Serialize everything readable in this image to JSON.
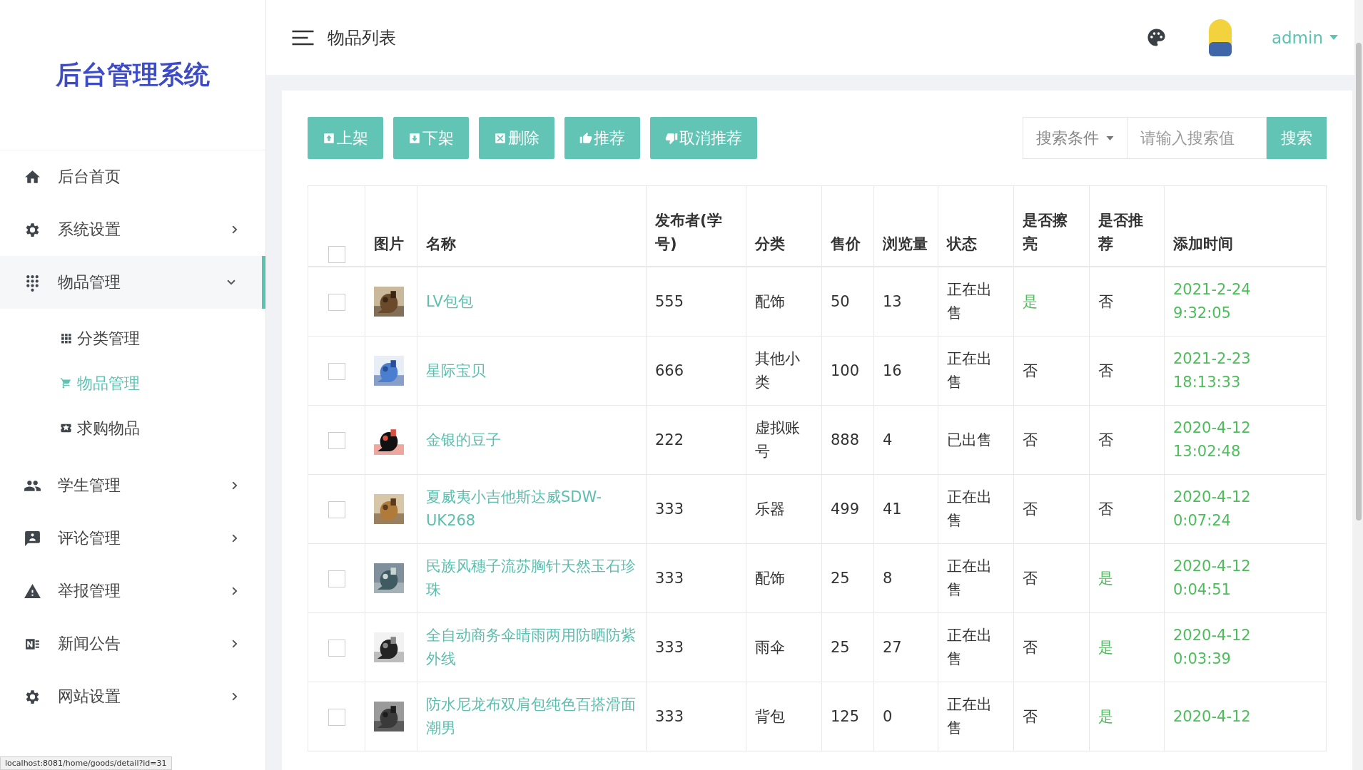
{
  "sidebar": {
    "title": "后台管理系统",
    "items": [
      {
        "label": "后台首页",
        "selected": false
      },
      {
        "label": "系统设置",
        "selected": false,
        "expanded": false
      },
      {
        "label": "物品管理",
        "selected": true,
        "expanded": true,
        "children": [
          {
            "label": "分类管理",
            "selected": false
          },
          {
            "label": "物品管理",
            "selected": true
          },
          {
            "label": "求购物品",
            "selected": false
          }
        ]
      },
      {
        "label": "学生管理",
        "selected": false,
        "expanded": false
      },
      {
        "label": "评论管理",
        "selected": false,
        "expanded": false
      },
      {
        "label": "举报管理",
        "selected": false,
        "expanded": false
      },
      {
        "label": "新闻公告",
        "selected": false,
        "expanded": false
      },
      {
        "label": "网站设置",
        "selected": false,
        "expanded": false
      }
    ]
  },
  "topbar": {
    "title": "物品列表",
    "user": "admin"
  },
  "toolbar": {
    "buttons": [
      {
        "label": "上架"
      },
      {
        "label": "下架"
      },
      {
        "label": "删除"
      },
      {
        "label": "推荐"
      },
      {
        "label": "取消推荐"
      }
    ],
    "search": {
      "condition": "搜索条件",
      "placeholder": "请输入搜索值",
      "button": "搜索"
    }
  },
  "table": {
    "columns": [
      "图片",
      "名称",
      "发布者(学号)",
      "分类",
      "售价",
      "浏览量",
      "状态",
      "是否擦亮",
      "是否推荐",
      "添加时间"
    ],
    "all_checked": false,
    "rows": [
      {
        "checked": false,
        "name": "LV包包",
        "publisher": "555",
        "category": "配饰",
        "price": "50",
        "views": "13",
        "status": "正在出售",
        "polished": {
          "text": "是",
          "on": true
        },
        "recommended": {
          "text": "否",
          "on": false
        },
        "added": "2021-2-24 9:32:05"
      },
      {
        "checked": false,
        "name": "星际宝贝",
        "publisher": "666",
        "category": "其他小类",
        "price": "100",
        "views": "16",
        "status": "正在出售",
        "polished": {
          "text": "否",
          "on": false
        },
        "recommended": {
          "text": "否",
          "on": false
        },
        "added": "2021-2-23 18:13:33"
      },
      {
        "checked": false,
        "name": "金银的豆子",
        "publisher": "222",
        "category": "虚拟账号",
        "price": "888",
        "views": "4",
        "status": "已出售",
        "polished": {
          "text": "否",
          "on": false
        },
        "recommended": {
          "text": "否",
          "on": false
        },
        "added": "2020-4-12 13:02:48"
      },
      {
        "checked": false,
        "name": "夏威夷小吉他斯达威SDW-UK268",
        "publisher": "333",
        "category": "乐器",
        "price": "499",
        "views": "41",
        "status": "正在出售",
        "polished": {
          "text": "否",
          "on": false
        },
        "recommended": {
          "text": "否",
          "on": false
        },
        "added": "2020-4-12 0:07:24"
      },
      {
        "checked": false,
        "name": "民族风穗子流苏胸针天然玉石珍珠",
        "publisher": "333",
        "category": "配饰",
        "price": "25",
        "views": "8",
        "status": "正在出售",
        "polished": {
          "text": "否",
          "on": false
        },
        "recommended": {
          "text": "是",
          "on": true
        },
        "added": "2020-4-12 0:04:51"
      },
      {
        "checked": false,
        "name": "全自动商务伞晴雨两用防晒防紫外线",
        "publisher": "333",
        "category": "雨伞",
        "price": "25",
        "views": "27",
        "status": "正在出售",
        "polished": {
          "text": "否",
          "on": false
        },
        "recommended": {
          "text": "是",
          "on": true
        },
        "added": "2020-4-12 0:03:39"
      },
      {
        "checked": false,
        "name": "防水尼龙布双肩包纯色百搭滑面潮男",
        "publisher": "333",
        "category": "背包",
        "price": "125",
        "views": "0",
        "status": "正在出售",
        "polished": {
          "text": "否",
          "on": false
        },
        "recommended": {
          "text": "是",
          "on": true
        },
        "added": "2020-4-12"
      }
    ]
  },
  "status_url": "localhost:8081/home/goods/detail?id=31"
}
